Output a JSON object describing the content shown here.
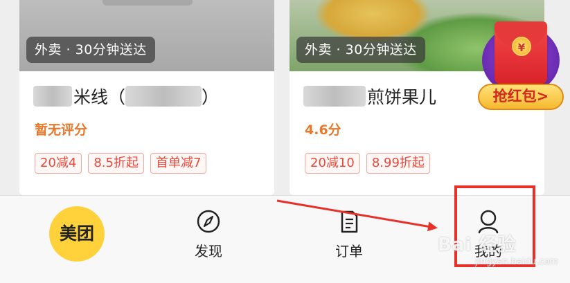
{
  "restaurants": [
    {
      "delivery_badge": "外卖 · 30分钟送达",
      "title_visible": "米线（",
      "title_end": "）",
      "rating": "暂无评分",
      "tags": [
        "20减4",
        "8.5折起",
        "首单减7"
      ]
    },
    {
      "delivery_badge": "外卖 · 30分钟送达",
      "title_visible": "煎饼果儿",
      "rating": "4.6分",
      "tags": [
        "20减10",
        "8.99折起"
      ]
    }
  ],
  "promo": {
    "coin_symbol": "¥",
    "button_label": "抢红包>"
  },
  "tabbar": {
    "home_logo": "美团",
    "discover_label": "发现",
    "orders_label": "订单",
    "mine_label": "我的"
  },
  "watermark": {
    "main": "Bai 经验",
    "sub": "jingyan.baidu.com"
  },
  "colors": {
    "accent_yellow": "#ffd23c",
    "rating_orange": "#e8782b",
    "tag_red": "#e8493b",
    "annotation_red": "#e8302b"
  }
}
